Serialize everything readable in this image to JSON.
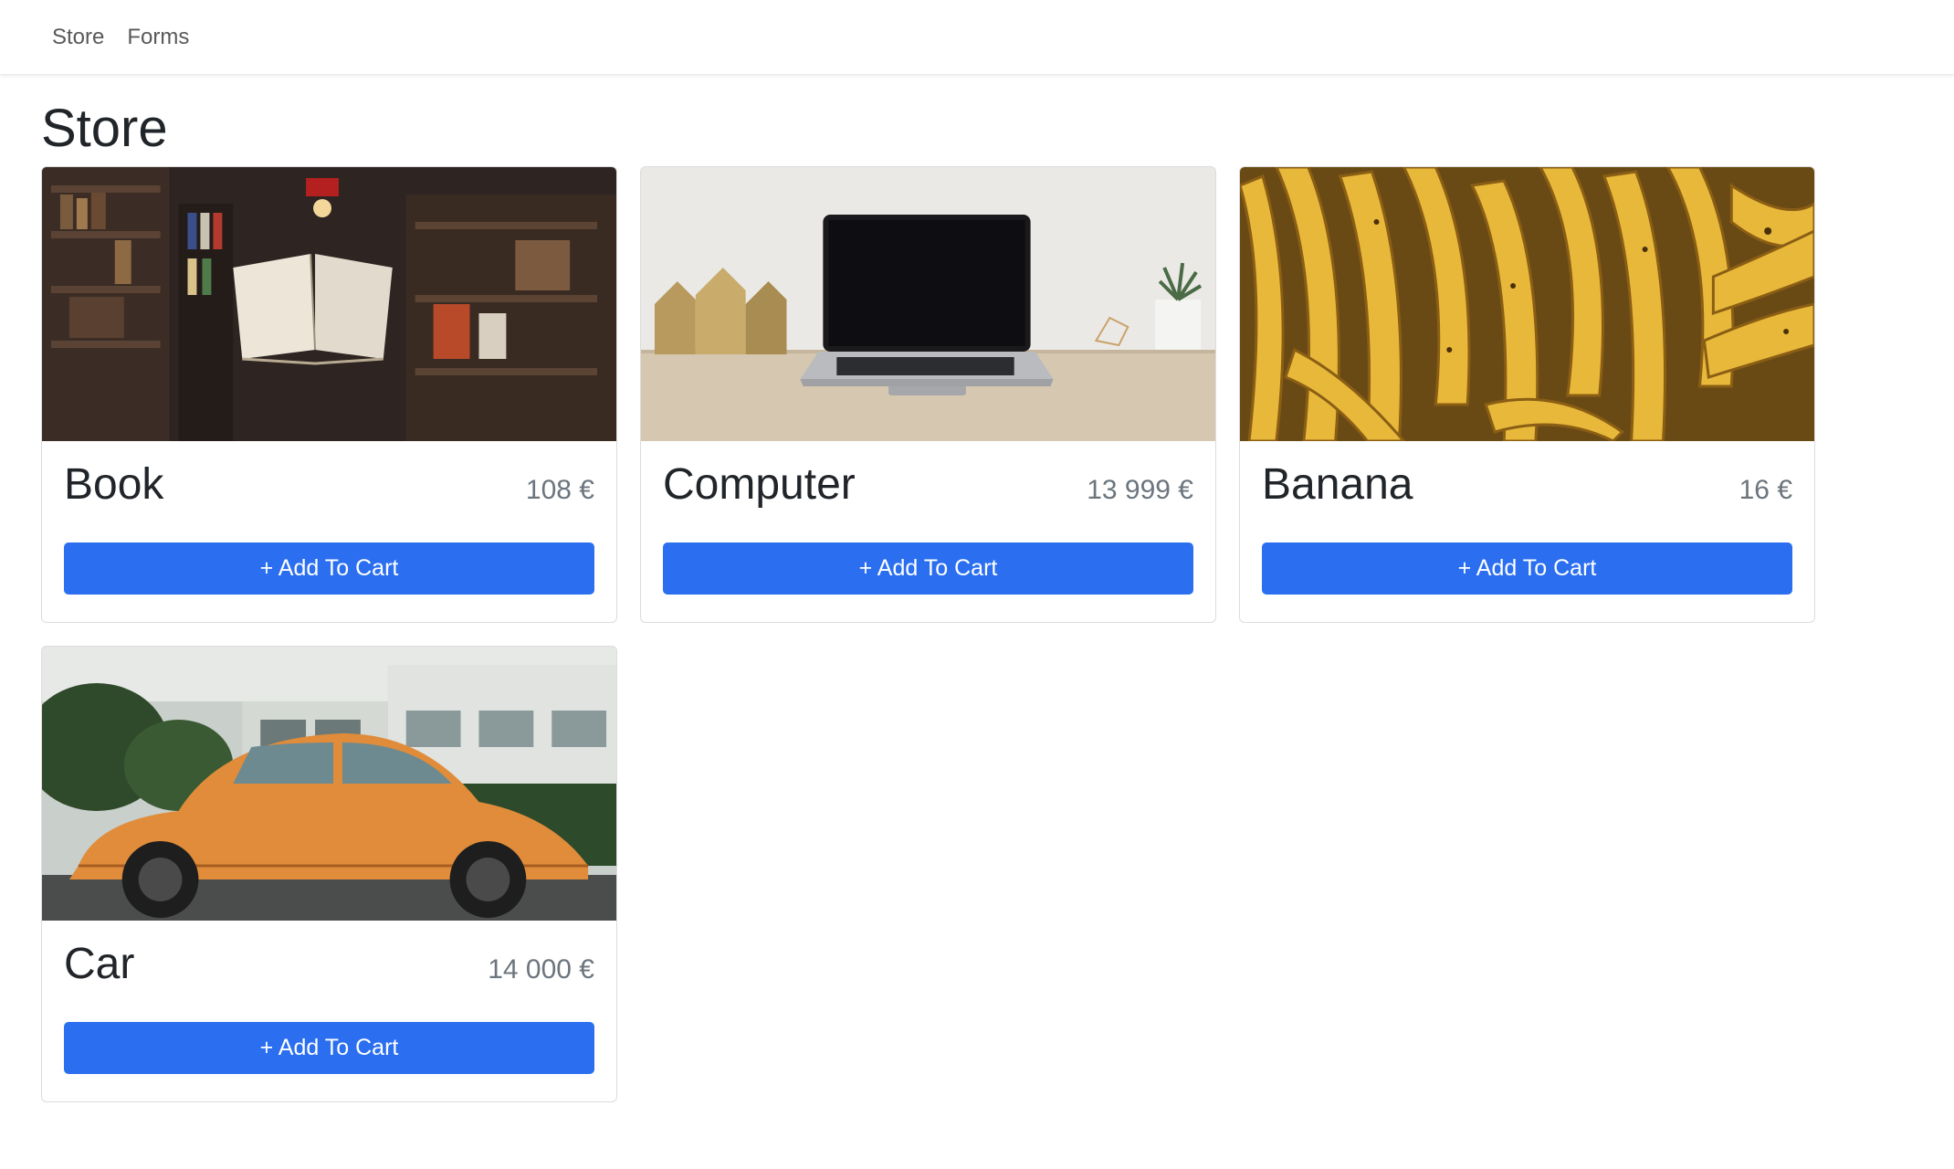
{
  "nav": {
    "links": [
      "Store",
      "Forms"
    ]
  },
  "page": {
    "title": "Store"
  },
  "button_label": "+ Add To Cart",
  "products": [
    {
      "name": "Book",
      "price": "108 €",
      "image": "floating-book-library"
    },
    {
      "name": "Computer",
      "price": "13 999 €",
      "image": "laptop-on-desk"
    },
    {
      "name": "Banana",
      "price": "16 €",
      "image": "banana-bunches"
    },
    {
      "name": "Car",
      "price": "14 000 €",
      "image": "orange-beetle-car"
    }
  ],
  "colors": {
    "primary": "#2b6ff0",
    "muted": "#6c757d",
    "text": "#212529"
  }
}
